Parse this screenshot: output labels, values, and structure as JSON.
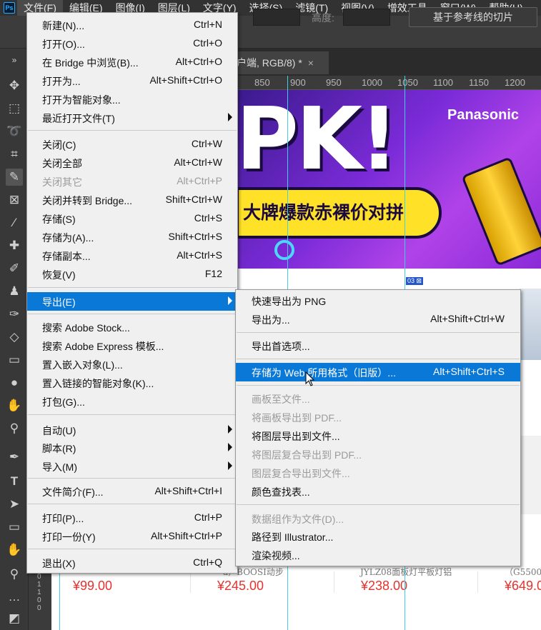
{
  "app": {
    "logo_text": "Ps"
  },
  "menubar": {
    "items": [
      "文件(F)",
      "编辑(E)",
      "图像(I)",
      "图层(L)",
      "文字(Y)",
      "选择(S)",
      "滤镜(T)",
      "视图(V)",
      "增效工具",
      "窗口(W)",
      "帮助(H)"
    ],
    "active_index": 0
  },
  "options_bar": {
    "height_label": "高度:",
    "slice_from_guides": "基于参考线的切片"
  },
  "document_tab": {
    "title": "户端, RGB/8) *",
    "close": "×"
  },
  "ruler": {
    "ticks": [
      "850",
      "900",
      "950",
      "1000",
      "1050",
      "1100",
      "1150",
      "1200"
    ]
  },
  "canvas": {
    "banner": {
      "big_text": "PK!",
      "brand": "Panasonic",
      "slogan": "大牌爆款赤裸价对拼"
    },
    "slice_badge": "03 ⊠",
    "products": [
      {
        "desc": "",
        "price": "¥99.00"
      },
      {
        "desc": "a）BOOSI动步",
        "price": "¥245.00"
      },
      {
        "desc": "JYLZ08面板灯平板灯铝",
        "price": "¥238.00"
      },
      {
        "desc": "（G5500）",
        "price": "¥649.0"
      }
    ],
    "left_ruler_digits": "3\n1\n0\n1\n1\n0\n0"
  },
  "file_menu": {
    "items": [
      {
        "label": "新建(N)...",
        "shortcut": "Ctrl+N"
      },
      {
        "label": "打开(O)...",
        "shortcut": "Ctrl+O"
      },
      {
        "label": "在 Bridge 中浏览(B)...",
        "shortcut": "Alt+Ctrl+O"
      },
      {
        "label": "打开为...",
        "shortcut": "Alt+Shift+Ctrl+O"
      },
      {
        "label": "打开为智能对象...",
        "shortcut": ""
      },
      {
        "label": "最近打开文件(T)",
        "shortcut": ""
      },
      {
        "label": "关闭(C)",
        "shortcut": "Ctrl+W"
      },
      {
        "label": "关闭全部",
        "shortcut": "Alt+Ctrl+W"
      },
      {
        "label": "关闭其它",
        "shortcut": "Alt+Ctrl+P"
      },
      {
        "label": "关闭并转到 Bridge...",
        "shortcut": "Shift+Ctrl+W"
      },
      {
        "label": "存储(S)",
        "shortcut": "Ctrl+S"
      },
      {
        "label": "存储为(A)...",
        "shortcut": "Shift+Ctrl+S"
      },
      {
        "label": "存储副本...",
        "shortcut": "Alt+Ctrl+S"
      },
      {
        "label": "恢复(V)",
        "shortcut": "F12"
      },
      {
        "label": "导出(E)",
        "shortcut": ""
      },
      {
        "label": "搜索 Adobe Stock...",
        "shortcut": ""
      },
      {
        "label": "搜索 Adobe Express 模板...",
        "shortcut": ""
      },
      {
        "label": "置入嵌入对象(L)...",
        "shortcut": ""
      },
      {
        "label": "置入链接的智能对象(K)...",
        "shortcut": ""
      },
      {
        "label": "打包(G)...",
        "shortcut": ""
      },
      {
        "label": "自动(U)",
        "shortcut": ""
      },
      {
        "label": "脚本(R)",
        "shortcut": ""
      },
      {
        "label": "导入(M)",
        "shortcut": ""
      },
      {
        "label": "文件简介(F)...",
        "shortcut": "Alt+Shift+Ctrl+I"
      },
      {
        "label": "打印(P)...",
        "shortcut": "Ctrl+P"
      },
      {
        "label": "打印一份(Y)",
        "shortcut": "Alt+Shift+Ctrl+P"
      },
      {
        "label": "退出(X)",
        "shortcut": "Ctrl+Q"
      }
    ]
  },
  "export_menu": {
    "items": [
      {
        "label": "快速导出为 PNG",
        "shortcut": ""
      },
      {
        "label": "导出为...",
        "shortcut": "Alt+Shift+Ctrl+W"
      },
      {
        "label": "导出首选项...",
        "shortcut": ""
      },
      {
        "label": "存储为 Web 所用格式（旧版）...",
        "shortcut": "Alt+Shift+Ctrl+S"
      },
      {
        "label": "画板至文件...",
        "shortcut": ""
      },
      {
        "label": "将画板导出到 PDF...",
        "shortcut": ""
      },
      {
        "label": "将图层导出到文件...",
        "shortcut": ""
      },
      {
        "label": "将图层复合导出到 PDF...",
        "shortcut": ""
      },
      {
        "label": "图层复合导出到文件...",
        "shortcut": ""
      },
      {
        "label": "颜色查找表...",
        "shortcut": ""
      },
      {
        "label": "数据组作为文件(D)...",
        "shortcut": ""
      },
      {
        "label": "路径到 Illustrator...",
        "shortcut": ""
      },
      {
        "label": "渲染视频...",
        "shortcut": ""
      }
    ]
  },
  "colors": {
    "highlight": "#0a78d7",
    "menu_bg": "#f0f0f0",
    "disabled": "#9b9b9b"
  }
}
